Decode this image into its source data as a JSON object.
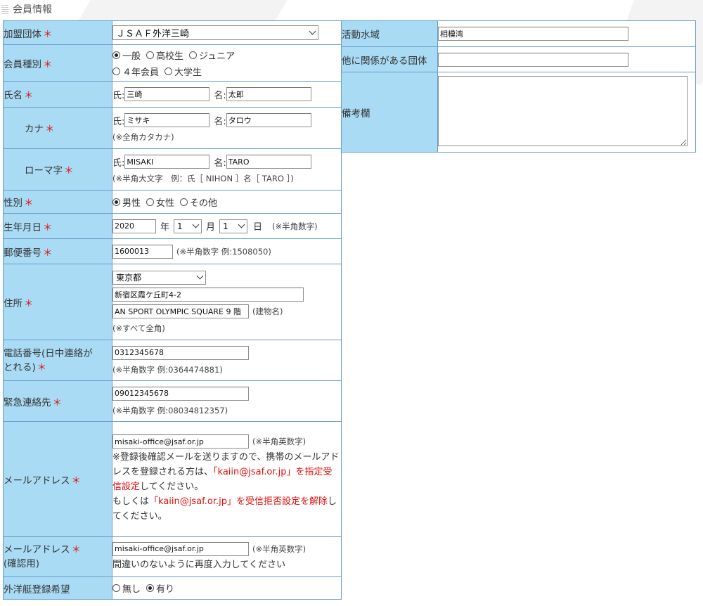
{
  "section_title": "会員情報",
  "required_mark": "＊",
  "colors": {
    "label_bg": "#a9dbf5",
    "border": "#6b9cc8",
    "required": "#e01010"
  },
  "fields": {
    "federation": {
      "label": "加盟団体",
      "value": "ＪＳＡＦ外洋三崎"
    },
    "member_type": {
      "label": "会員種別",
      "options": [
        "一般",
        "高校生",
        "ジュニア",
        "４年会員",
        "大学生"
      ],
      "selected": "一般"
    },
    "name": {
      "label": "氏名",
      "last_label": "氏:",
      "last_value": "三崎",
      "first_label": "名:",
      "first_value": "太郎"
    },
    "kana": {
      "label": "カナ",
      "last_label": "氏:",
      "last_value": "ミサキ",
      "first_label": "名:",
      "first_value": "タロウ",
      "note": "(※全角カタカナ)"
    },
    "roman": {
      "label": "ローマ字",
      "last_label": "氏:",
      "last_value": "MISAKI",
      "first_label": "名:",
      "first_value": "TARO",
      "note": "(※半角大文字　例：氏［ NIHON ］名［ TARO ］)"
    },
    "gender": {
      "label": "性別",
      "options": [
        "男性",
        "女性",
        "その他"
      ],
      "selected": "男性"
    },
    "birthdate": {
      "label": "生年月日",
      "year": "2020",
      "year_unit": "年",
      "month": "1",
      "month_unit": "月",
      "day": "1",
      "day_unit": "日",
      "note": "(※半角数字)"
    },
    "postal": {
      "label": "郵便番号",
      "value": "1600013",
      "note": "(※半角数字 例:1508050)"
    },
    "address": {
      "label": "住所",
      "prefecture": "東京都",
      "line1": "新宿区霞ケ丘町4-2",
      "line2": "AN SPORT OLYMPIC SQUARE 9 階",
      "building_note": "(建物名)",
      "note": "(※すべて全角)"
    },
    "phone": {
      "label_line1": "電話番号(日中連絡が",
      "label_line2": "とれる)",
      "value": "0312345678",
      "note": "(※半角数字 例:0364474881)"
    },
    "emergency": {
      "label": "緊急連絡先",
      "value": "09012345678",
      "note": "(※半角数字 例:08034812357)"
    },
    "email": {
      "label": "メールアドレス",
      "value": "misaki-office@jsaf.or.jp",
      "note": "(※半角英数字)",
      "msg1": "※登録後確認メールを送りますので、携帯のメールアドレスを登録される方は、",
      "msg2_red": "「kaiin@jsaf.or.jp」を指定受信設定",
      "msg2_rest": "してください。",
      "msg3_pre": "もしくは",
      "msg3_red": "「kaiin@jsaf.or.jp」を受信拒否設定を解除",
      "msg3_rest": "してください。"
    },
    "email_confirm": {
      "label_line1": "メールアドレス",
      "label_line2": "(確認用)",
      "value": "misaki-office@jsaf.or.jp",
      "note": "(※半角英数字)",
      "hint": "間違いのないように再度入力してください"
    },
    "offshore": {
      "label": "外洋艇登録希望",
      "options": [
        "無し",
        "有り"
      ],
      "selected": "有り"
    },
    "water_area": {
      "label": "活動水域",
      "value": "相模湾"
    },
    "other_org": {
      "label": "他に関係がある団体",
      "value": ""
    },
    "remarks": {
      "label": "備考欄",
      "value": ""
    }
  }
}
